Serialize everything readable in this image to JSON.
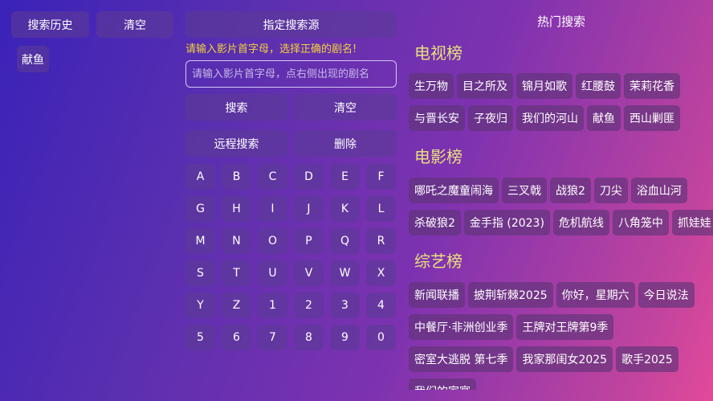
{
  "history": {
    "title": "搜索历史",
    "clear_label": "清空",
    "items": [
      "献鱼"
    ]
  },
  "search": {
    "source_label": "指定搜索源",
    "hint": "请输入影片首字母，选择正确的剧名!",
    "placeholder": "请输入影片首字母，点右侧出现的剧名",
    "search_label": "搜索",
    "clear_label": "清空",
    "remote_label": "远程搜索",
    "delete_label": "删除"
  },
  "keyboard": {
    "keys": [
      "A",
      "B",
      "C",
      "D",
      "E",
      "F",
      "G",
      "H",
      "I",
      "J",
      "K",
      "L",
      "M",
      "N",
      "O",
      "P",
      "Q",
      "R",
      "S",
      "T",
      "U",
      "V",
      "W",
      "X",
      "Y",
      "Z",
      "1",
      "2",
      "3",
      "4",
      "5",
      "6",
      "7",
      "8",
      "9",
      "0"
    ]
  },
  "hot": {
    "title": "热门搜索",
    "sections": [
      {
        "title": "电视榜",
        "rows": [
          [
            "生万物",
            "目之所及",
            "锦月如歌",
            "红腰鼓",
            "茉莉花香"
          ],
          [
            "与晋长安",
            "子夜归",
            "我们的河山",
            "献鱼",
            "西山剿匪"
          ]
        ]
      },
      {
        "title": "电影榜",
        "rows": [
          [
            "哪吒之魔童闹海",
            "三叉戟",
            "战狼2",
            "刀尖",
            "浴血山河"
          ],
          [
            "杀破狼2",
            "金手指 (2023)",
            "危机航线",
            "八角笼中",
            "抓娃娃"
          ]
        ]
      },
      {
        "title": "综艺榜",
        "rows": [
          [
            "新闻联播",
            "披荆斩棘2025",
            "你好，星期六",
            "今日说法"
          ],
          [
            "中餐厅·非洲创业季",
            "王牌对王牌第9季"
          ],
          [
            "密室大逃脱 第七季",
            "我家那闺女2025",
            "歌手2025"
          ],
          [
            "我们的家宴"
          ]
        ]
      }
    ]
  }
}
